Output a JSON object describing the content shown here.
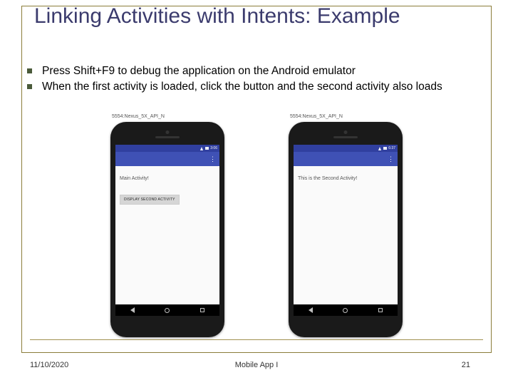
{
  "slide": {
    "title": "Linking  Activities  with  Intents: Example",
    "bullets": [
      "Press Shift+F9 to debug the application on the Android emulator",
      "When the first activity is loaded, click the button and the second activity also loads"
    ]
  },
  "emulator_label": "5554:Nexus_5X_API_N",
  "status": {
    "time1": "3:06",
    "time2": "6:37"
  },
  "phone1": {
    "activity_title": "Main Activity!",
    "button_label": "DISPLAY SECOND ACTIVITY"
  },
  "phone2": {
    "activity_title": "This is the Second Activity!"
  },
  "footer": {
    "date": "11/10/2020",
    "center": "Mobile App I",
    "page": "21"
  }
}
